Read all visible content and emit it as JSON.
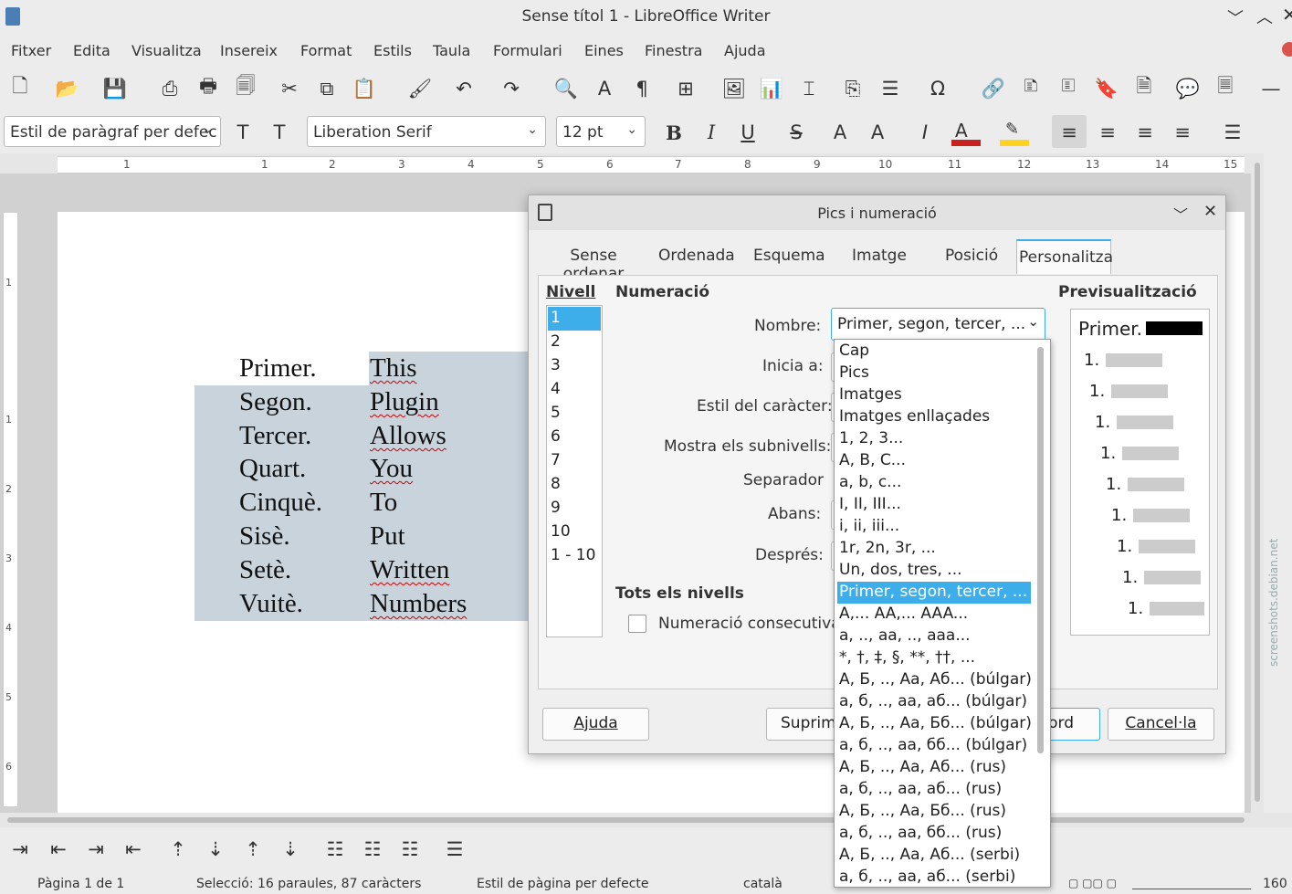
{
  "window": {
    "title": "Sense títol 1 - LibreOffice Writer"
  },
  "menu": [
    "Fitxer",
    "Edita",
    "Visualitza",
    "Insereix",
    "Format",
    "Estils",
    "Taula",
    "Formulari",
    "Eines",
    "Finestra",
    "Ajuda"
  ],
  "formatting": {
    "paragraph_style": "Estil de paràgraf per defec",
    "font_name": "Liberation Serif",
    "font_size": "12 pt"
  },
  "ruler_numbers": [
    "1",
    "1",
    "2",
    "3",
    "4",
    "5",
    "6",
    "7",
    "8",
    "9",
    "10",
    "11",
    "12",
    "13",
    "14",
    "15"
  ],
  "vruler_numbers": [
    "1",
    "1",
    "2",
    "3",
    "4",
    "5",
    "6"
  ],
  "document": {
    "col1": [
      "Primer.",
      "Segon.",
      "Tercer.",
      "Quart.",
      "Cinquè.",
      "Sisè.",
      "Setè.",
      "Vuitè."
    ],
    "col2": [
      "This",
      "Plugin",
      "Allows",
      "You",
      "To",
      "Put",
      "Written",
      "Numbers"
    ]
  },
  "dialog": {
    "title": "Pics i numeració",
    "tabs": [
      "Sense ordenar",
      "Ordenada",
      "Esquema",
      "Imatge",
      "Posició",
      "Personalitza"
    ],
    "active_tab": "Personalitza",
    "level_heading": "Nivell",
    "levels": [
      "1",
      "2",
      "3",
      "4",
      "5",
      "6",
      "7",
      "8",
      "9",
      "10",
      "1 - 10"
    ],
    "selected_level": "1",
    "numbering_heading": "Numeració",
    "fields": {
      "number_label": "Nombre:",
      "number_value": "Primer, segon, tercer, ...",
      "start_label": "Inicia a:",
      "char_style_label": "Estil del caràcter:",
      "sublevels_label": "Mostra els subnivells:",
      "separator_label": "Separador",
      "before_label": "Abans:",
      "after_label": "Després:"
    },
    "all_levels_heading": "Tots els nivells",
    "consecutive_label": "Numeració consecutiva",
    "preview_heading": "Previsualització",
    "preview_first": "Primer.",
    "preview_items": [
      "1.",
      "1.",
      "1.",
      "1.",
      "1.",
      "1.",
      "1.",
      "1.",
      "1."
    ],
    "buttons": {
      "help": "Ajuda",
      "remove": "Suprim",
      "ok": "ord",
      "cancel": "Cancel·la"
    }
  },
  "dropdown_options": [
    "Cap",
    "Pics",
    "Imatges",
    "Imatges enllaçades",
    "1, 2, 3...",
    "A, B, C...",
    "a, b, c...",
    "I, II, III...",
    "i, ii, iii...",
    "1r, 2n, 3r, ...",
    "Un, dos, tres, ...",
    "Primer, segon, tercer, ...",
    "A,... AA,... AAA...",
    "a, .., aa, .., aaa...",
    "*, †, ‡, §, **, ††, ...",
    "А, Б, .., Аа, Аб... (búlgar)",
    "а, б, .., аа, аб... (búlgar)",
    "А, Б, .., Аа, Бб... (búlgar)",
    "а, б, .., аа, бб... (búlgar)",
    "А, Б, .., Аа, Аб... (rus)",
    "а, б, .., аа, аб... (rus)",
    "А, Б, .., Аа, Бб... (rus)",
    "а, б, .., аа, бб... (rus)",
    "А, Б, .., Аа, Аб... (serbi)",
    "а, б, .., аа, аб... (serbi)"
  ],
  "dropdown_selected": "Primer, segon, tercer, ...",
  "statusbar": {
    "page": "Pàgina 1 de 1",
    "selection": "Selecció: 16 paraules, 87 caràcters",
    "page_style": "Estil de pàgina per defecte",
    "language": "català",
    "zoom": "160"
  },
  "watermark": "screenshots.debian.net"
}
